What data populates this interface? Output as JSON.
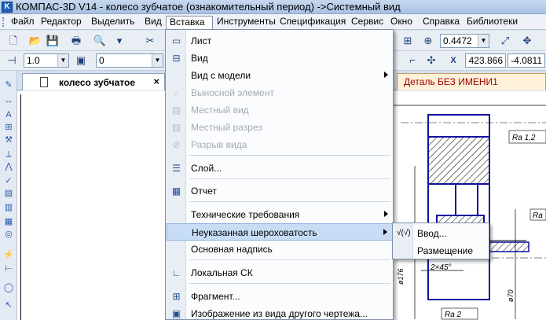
{
  "window": {
    "title": "КОМПАС-3D V14 - колесо зубчатое (ознакомительный период) ->Системный вид"
  },
  "menubar": [
    {
      "label": "Файл"
    },
    {
      "label": "Редактор"
    },
    {
      "label": "Выделить"
    },
    {
      "label": "Вид"
    },
    {
      "label": "Вставка"
    },
    {
      "label": "Инструменты"
    },
    {
      "label": "Спецификация"
    },
    {
      "label": "Сервис"
    },
    {
      "label": "Окно"
    },
    {
      "label": "Справка"
    },
    {
      "label": "Библиотеки"
    }
  ],
  "toolbar": {
    "zoom": "0.4472",
    "line_scale": "1.0",
    "layer": "0",
    "coord_x": "423.866",
    "coord_y": "-4.0811",
    "x_label": "X"
  },
  "tabs": {
    "active": "колесо зубчатое",
    "second": "Деталь БЕЗ ИМЕНИ1"
  },
  "insert_menu": [
    {
      "label": "Лист",
      "icon": "sheet-icon",
      "enabled": true
    },
    {
      "label": "Вид",
      "icon": "view-icon",
      "enabled": true
    },
    {
      "label": "Вид с модели",
      "icon": "",
      "enabled": true,
      "submenu": true
    },
    {
      "label": "Выносной элемент",
      "icon": "callout-icon",
      "enabled": false
    },
    {
      "label": "Местный вид",
      "icon": "local-view-icon",
      "enabled": false
    },
    {
      "label": "Местный разрез",
      "icon": "local-section-icon",
      "enabled": false
    },
    {
      "label": "Разрыв вида",
      "icon": "view-break-icon",
      "enabled": false
    },
    {
      "label": "Слой...",
      "icon": "layer-icon",
      "enabled": true
    },
    {
      "label": "Отчет",
      "icon": "report-icon",
      "enabled": true
    },
    {
      "label": "Технические требования",
      "icon": "",
      "enabled": true,
      "submenu": true
    },
    {
      "label": "Неуказанная шероховатость",
      "icon": "",
      "enabled": true,
      "submenu": true,
      "highlighted": true
    },
    {
      "label": "Основная надпись",
      "icon": "",
      "enabled": true
    },
    {
      "label": "Локальная СК",
      "icon": "local-cs-icon",
      "enabled": true
    },
    {
      "label": "Фрагмент...",
      "icon": "fragment-icon",
      "enabled": true
    },
    {
      "label": "Изображение из вида другого чертежа...",
      "icon": "image-icon",
      "enabled": true
    }
  ],
  "roughness_submenu": [
    {
      "label": "Ввод...",
      "icon_text": "√(√)"
    },
    {
      "label": "Размещение",
      "icon_text": ""
    }
  ],
  "drawing_labels": {
    "ra1": "Ra 1,2",
    "ra2": "Ra",
    "chamfer": "2×45°",
    "dia1": "ø176",
    "dia2": "ø70",
    "ra3": "Ra 2"
  }
}
